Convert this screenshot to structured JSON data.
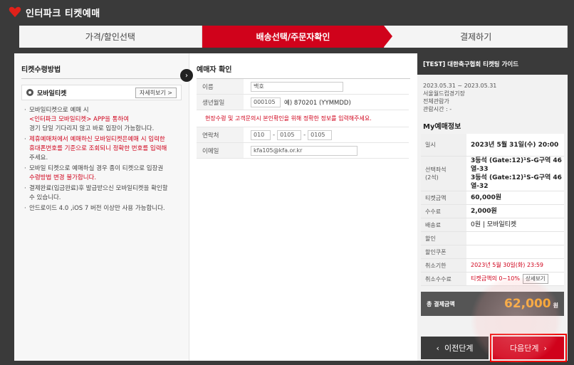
{
  "window": {
    "title": "인터파크 티켓예매"
  },
  "steps": [
    {
      "label": "가격/할인선택",
      "active": false
    },
    {
      "label": "배송선택/주문자확인",
      "active": true
    },
    {
      "label": "결제하기",
      "active": false
    }
  ],
  "ticket_method": {
    "title": "티켓수령방법",
    "option": "모바일티켓",
    "detail_button": "자세히보기 >",
    "notes": [
      {
        "parts": [
          {
            "t": "모바일티켓으로 예매 시",
            "red": false
          },
          {
            "t": "<인터파크 모바일티켓> APP을 통하여",
            "red": true
          },
          {
            "t": "경기 당일 기다리지 않고 바로 입장이 가능합니다.",
            "red": false
          }
        ]
      },
      {
        "parts": [
          {
            "t": "제휴예매처에서 예매하신 모바일티켓은예매 시 입력한",
            "red": true
          },
          {
            "t": "휴대폰번호를 기준으로 조회되니 정확한 번호를 입력해",
            "red": true
          },
          {
            "t": "주세요.",
            "red": false
          }
        ]
      },
      {
        "parts": [
          {
            "t": "모바일 티켓으로 예매하실 경우 종이 티켓으로 입장권",
            "red": false
          },
          {
            "t": "수령방법 변경 불가합니다.",
            "red": true
          }
        ]
      },
      {
        "parts": [
          {
            "t": "결제완료(입금완료)후 발급받으신 모바일티켓을 확인할",
            "red": false
          },
          {
            "t": "수 있습니다.",
            "red": false
          }
        ]
      },
      {
        "parts": [
          {
            "t": "안드로이드 4.0 ,iOS 7 버전 이상만 사용 가능합니다.",
            "red": false
          }
        ]
      }
    ]
  },
  "booker": {
    "title": "예매자 확인",
    "name_label": "이름",
    "name_value": "백호",
    "birth_label": "생년월일",
    "birth_value": "000105",
    "birth_hint": "예) 870201 (YYMMDD)",
    "warning": "현장수령 및 고객문의시 본인확인을 위해 정확한 정보를 입력해주세요.",
    "phone_label": "연락처",
    "phone": [
      "010",
      "0105",
      "0105"
    ],
    "email_label": "이메일",
    "email_value": "kfa105@kfa.or.kr"
  },
  "sidebar": {
    "header": "[TEST] 대한축구협회 티켓팅 가이드",
    "period": "2023.05.31 ~ 2023.05.31",
    "venue": "서울월드컵경기장",
    "seat_type": "전체관람가",
    "runtime": "관람시간 : -",
    "my_title": "My예매정보",
    "rows": [
      {
        "k": "일시",
        "v": "2023년 5월 31일(수) 20:00",
        "style": "bold"
      },
      {
        "k": "선택좌석\n(2석)",
        "v": "3등석 (Gate:12)¹S-G구역 46열-33\n3등석 (Gate:12)¹S-G구역 46열-32",
        "style": "bold"
      },
      {
        "k": "티켓금액",
        "v": "60,000원",
        "style": "bold"
      },
      {
        "k": "수수료",
        "v": "2,000원",
        "style": "bold"
      },
      {
        "k": "배송료",
        "v": "0원 | 모바일티켓",
        "style": ""
      },
      {
        "k": "할인",
        "v": "",
        "style": ""
      },
      {
        "k": "할인쿠폰",
        "v": "",
        "style": ""
      },
      {
        "k": "취소기한",
        "v": "2023년 5월 30일(화) 23:59",
        "style": "red"
      },
      {
        "k": "취소수수료",
        "v": "티켓금액의 0~10%",
        "style": "red"
      }
    ],
    "cancel_fee_btn": "상세보기",
    "total_label": "총 결제금액",
    "total_value": "62,000",
    "total_unit": "원",
    "prev_button": "이전단계",
    "next_button": "다음단계"
  }
}
